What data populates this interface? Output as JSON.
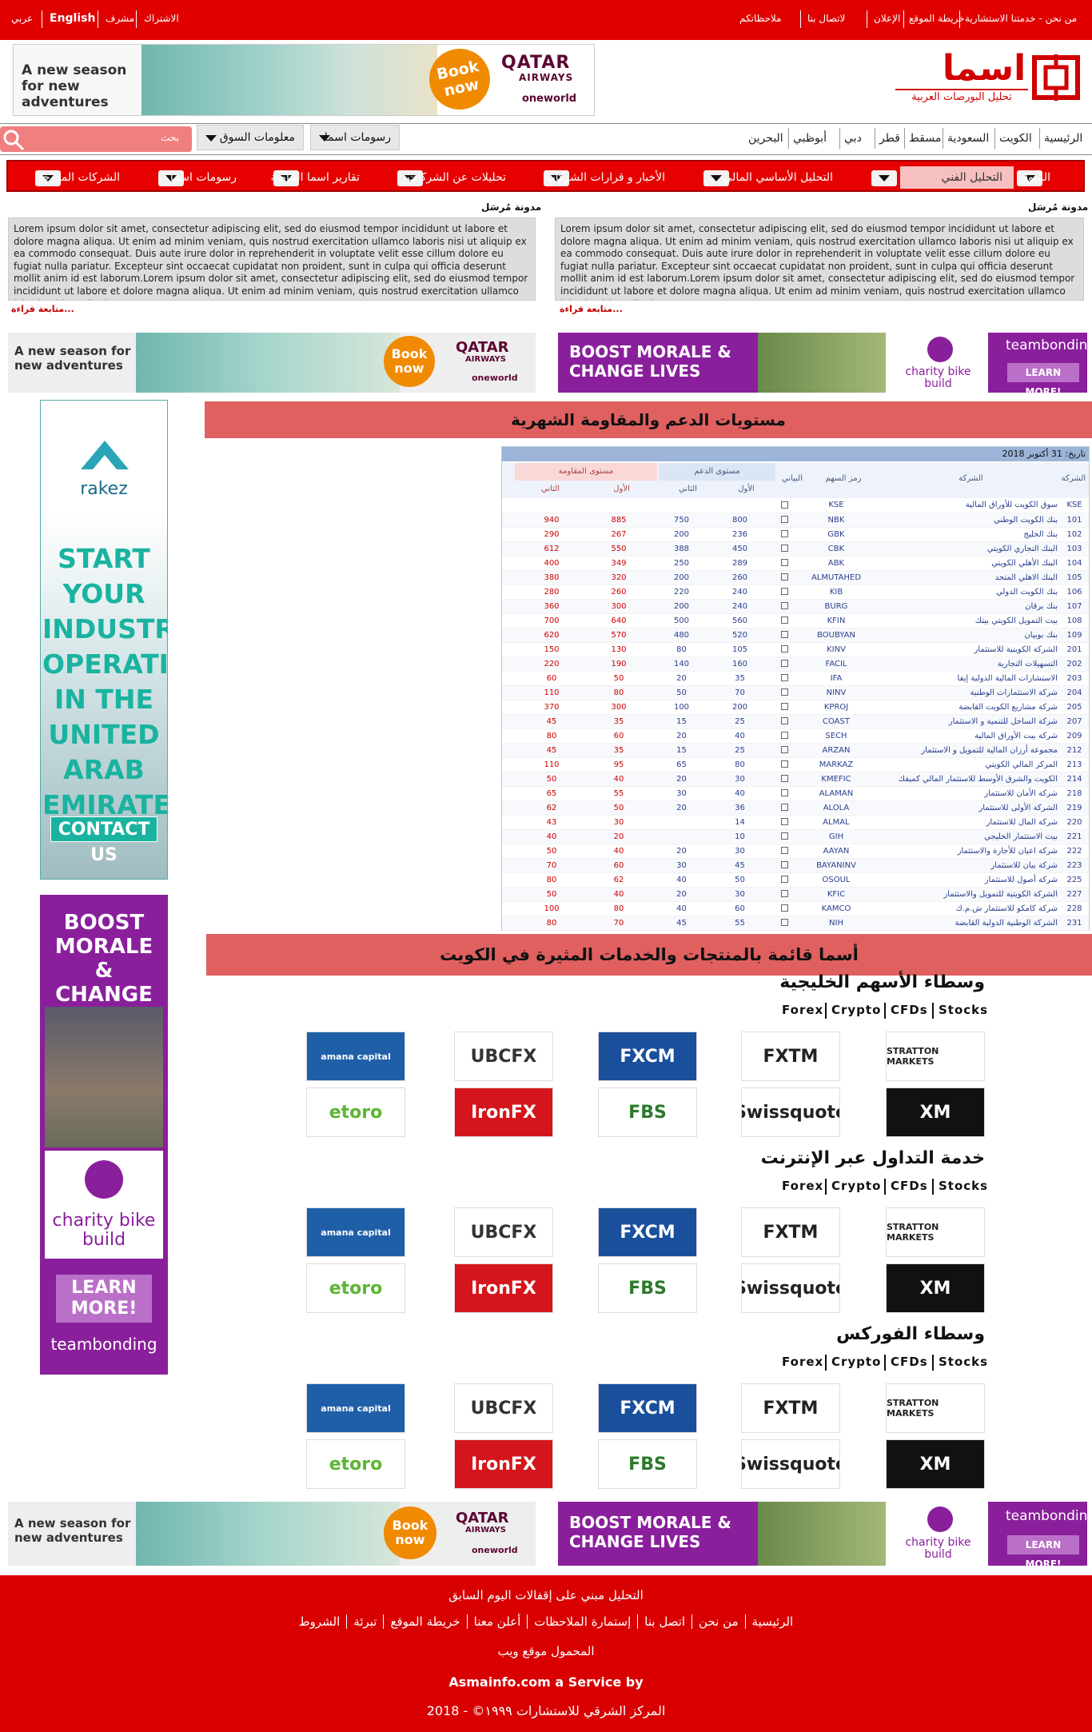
{
  "topbar": {
    "left": [
      {
        "label": "عربي"
      },
      {
        "label": "English"
      },
      {
        "label": "مشرف"
      },
      {
        "label": "الاشتراك"
      }
    ],
    "right": [
      {
        "label": "من نحن - خدمتنا الاستشارية"
      },
      {
        "label": "خريطة الموقع"
      },
      {
        "label": "الإعلان"
      },
      {
        "label": "لاتصال بنا"
      },
      {
        "label": "ملاحظاتكم"
      }
    ]
  },
  "logo": {
    "title": "اسما",
    "subtitle": "تحليل البورصات العربية"
  },
  "ads": {
    "qatar": {
      "tagline": "A new season for new adventures",
      "book": "Book now",
      "brand": "QATAR",
      "brand2": "AIRWAYS",
      "alliance": "oneworld"
    },
    "boost": {
      "headline": "BOOST MORALE & CHANGE LIVES",
      "charity": "charity bike build",
      "brand": "teambonding",
      "cta": "LEARN MORE!"
    },
    "rakez": {
      "brand": "rakez",
      "headline": "START YOUR INDUSTRIAL OPERATIONS IN THE UNITED ARAB EMIRATES",
      "cta": "CONTACT US"
    }
  },
  "nav": {
    "markets": [
      "الرئيسية",
      "الكويت",
      "السعودية",
      "مسقط",
      "قطر",
      "دبي",
      "أبوظبي",
      "البحرين"
    ],
    "dropdowns": [
      {
        "label": "رسومات اسما"
      },
      {
        "label": "معلومات السوق"
      }
    ],
    "search_placeholder": "بحث"
  },
  "menu": [
    {
      "label": "السوق"
    },
    {
      "label": "التحليل الفني"
    },
    {
      "label": "التحليل الأساسي المالي"
    },
    {
      "label": "الأخبار و قرارات الشركات"
    },
    {
      "label": "تحليلات عن الشركات"
    },
    {
      "label": "تقارير اسما الخاصة"
    },
    {
      "label": "رسومات اسما"
    },
    {
      "label": "الشركات المدرجة"
    }
  ],
  "blogs": [
    {
      "title": "مدونة مُرسَل",
      "more": "متابعة قراءة...",
      "text": "Lorem ipsum dolor sit amet, consectetur adipiscing elit, sed do eiusmod tempor incididunt ut labore et dolore magna aliqua. Ut enim ad minim veniam, quis nostrud exercitation ullamco laboris nisi ut aliquip ex ea commodo consequat. Duis aute irure dolor in reprehenderit in voluptate velit esse cillum dolore eu fugiat nulla pariatur. Excepteur sint occaecat cupidatat non proident, sunt in culpa qui officia deserunt mollit anim id est laborum.Lorem ipsum dolor sit amet, consectetur adipiscing elit, sed do eiusmod tempor incididunt ut labore et dolore magna aliqua. Ut enim ad minim veniam, quis nostrud exercitation ullamco laboris nisi ut aliquip ex ea"
    },
    {
      "title": "مدونة مُرسَل",
      "more": "متابعة قراءة...",
      "text": "Lorem ipsum dolor sit amet, consectetur adipiscing elit, sed do eiusmod tempor incididunt ut labore et dolore magna aliqua. Ut enim ad minim veniam, quis nostrud exercitation ullamco laboris nisi ut aliquip ex ea commodo consequat. Duis aute irure dolor in reprehenderit in voluptate velit esse cillum dolore eu fugiat nulla pariatur. Excepteur sint occaecat cupidatat non proident, sunt in culpa qui officia deserunt mollit anim id est laborum.Lorem ipsum dolor sit amet, consectetur adipiscing elit, sed do eiusmod tempor incididunt ut labore et dolore magna aliqua. Ut enim ad minim veniam, quis nostrud exercitation ullamco laboris nisi ut aliquip ex ea"
    }
  ],
  "levels": {
    "title": "مستويات الدعم والمقاومة الشهرية",
    "date": "تاريخ: 31 أكتوبر 2018",
    "headers": {
      "code": "الشركة",
      "company": "الشركة",
      "symbol": "رمز السهم",
      "chart": "البياني",
      "support": "مستوى الدعم",
      "resistance": "مستوى المقاومة",
      "first": "الأول",
      "second": "الثاني"
    },
    "rows": [
      {
        "n": "KSE",
        "name": "سوق الكويت للأوراق المالية",
        "sym": "KSE",
        "s1": "",
        "s2": "",
        "r1": "",
        "r2": ""
      },
      {
        "n": "101",
        "name": "بنك الكويت الوطني",
        "sym": "NBK",
        "s1": "800",
        "s2": "750",
        "r1": "885",
        "r2": "940"
      },
      {
        "n": "102",
        "name": "بنك الخليج",
        "sym": "GBK",
        "s1": "236",
        "s2": "200",
        "r1": "267",
        "r2": "290"
      },
      {
        "n": "103",
        "name": "البنك التجاري الكويتي",
        "sym": "CBK",
        "s1": "450",
        "s2": "388",
        "r1": "550",
        "r2": "612"
      },
      {
        "n": "104",
        "name": "البنك الأهلي الكويتي",
        "sym": "ABK",
        "s1": "289",
        "s2": "250",
        "r1": "349",
        "r2": "400"
      },
      {
        "n": "105",
        "name": "البنك الاهلي المتحد",
        "sym": "ALMUTAHED",
        "s1": "260",
        "s2": "200",
        "r1": "320",
        "r2": "380"
      },
      {
        "n": "106",
        "name": "بنك الكويت الدولي",
        "sym": "KIB",
        "s1": "240",
        "s2": "220",
        "r1": "260",
        "r2": "280"
      },
      {
        "n": "107",
        "name": "بنك برقان",
        "sym": "BURG",
        "s1": "240",
        "s2": "200",
        "r1": "300",
        "r2": "360"
      },
      {
        "n": "108",
        "name": "بيت التمويل الكويتي بيتك",
        "sym": "KFIN",
        "s1": "560",
        "s2": "500",
        "r1": "640",
        "r2": "700"
      },
      {
        "n": "109",
        "name": "بنك بوبيان",
        "sym": "BOUBYAN",
        "s1": "520",
        "s2": "480",
        "r1": "570",
        "r2": "620"
      },
      {
        "n": "201",
        "name": "الشركة الكويتية للاستثمار",
        "sym": "KINV",
        "s1": "105",
        "s2": "80",
        "r1": "130",
        "r2": "150"
      },
      {
        "n": "202",
        "name": "التسهيلات التجارية",
        "sym": "FACIL",
        "s1": "160",
        "s2": "140",
        "r1": "190",
        "r2": "220"
      },
      {
        "n": "203",
        "name": "الاستشارات المالية الدولية إيفا",
        "sym": "IFA",
        "s1": "35",
        "s2": "20",
        "r1": "50",
        "r2": "60"
      },
      {
        "n": "204",
        "name": "شركة الاستثمارات الوطنية",
        "sym": "NINV",
        "s1": "70",
        "s2": "50",
        "r1": "80",
        "r2": "110"
      },
      {
        "n": "205",
        "name": "شركة مشاريع الكويت القابضة",
        "sym": "KPROJ",
        "s1": "200",
        "s2": "100",
        "r1": "300",
        "r2": "370"
      },
      {
        "n": "207",
        "name": "شركة الساحل للتنمية و الاستثمار",
        "sym": "COAST",
        "s1": "25",
        "s2": "15",
        "r1": "35",
        "r2": "45"
      },
      {
        "n": "209",
        "name": "شركة بيت الأوراق المالية",
        "sym": "SECH",
        "s1": "40",
        "s2": "20",
        "r1": "60",
        "r2": "80"
      },
      {
        "n": "212",
        "name": "مجموعة أرزان المالية للتمويل و الاستثمار",
        "sym": "ARZAN",
        "s1": "25",
        "s2": "15",
        "r1": "35",
        "r2": "45"
      },
      {
        "n": "213",
        "name": "المركز المالي الكويتي",
        "sym": "MARKAZ",
        "s1": "80",
        "s2": "65",
        "r1": "95",
        "r2": "110"
      },
      {
        "n": "214",
        "name": "الكويت والشرق الأوسط للاستثمار المالي كميفك",
        "sym": "KMEFIC",
        "s1": "30",
        "s2": "20",
        "r1": "40",
        "r2": "50"
      },
      {
        "n": "218",
        "name": "شركة الأمان للاستثمار",
        "sym": "ALAMAN",
        "s1": "40",
        "s2": "30",
        "r1": "55",
        "r2": "65"
      },
      {
        "n": "219",
        "name": "الشركة الأولى للاستثمار",
        "sym": "ALOLA",
        "s1": "36",
        "s2": "20",
        "r1": "50",
        "r2": "62"
      },
      {
        "n": "220",
        "name": "شركة المال للاستثمار",
        "sym": "ALMAL",
        "s1": "14",
        "s2": "",
        "r1": "30",
        "r2": "43"
      },
      {
        "n": "221",
        "name": "بيت الاستثمار الخليجي",
        "sym": "GIH",
        "s1": "10",
        "s2": "",
        "r1": "20",
        "r2": "40"
      },
      {
        "n": "222",
        "name": "شركة اعيان للأجارة والاستثمار",
        "sym": "AAYAN",
        "s1": "30",
        "s2": "20",
        "r1": "40",
        "r2": "50"
      },
      {
        "n": "223",
        "name": "شركة بيان للاستثمار",
        "sym": "BAYANINV",
        "s1": "45",
        "s2": "30",
        "r1": "60",
        "r2": "70"
      },
      {
        "n": "225",
        "name": "شركة أصول للاستثمار",
        "sym": "OSOUL",
        "s1": "50",
        "s2": "40",
        "r1": "62",
        "r2": "80"
      },
      {
        "n": "227",
        "name": "الشركة الكويتية للتمويل والاستثمار",
        "sym": "KFIC",
        "s1": "30",
        "s2": "20",
        "r1": "40",
        "r2": "50"
      },
      {
        "n": "228",
        "name": "شركة كامكو للاستثمار ش.م.ك",
        "sym": "KAMCO",
        "s1": "60",
        "s2": "40",
        "r1": "80",
        "r2": "100"
      },
      {
        "n": "231",
        "name": "الشركة الوطنية الدولية القابضة",
        "sym": "NIH",
        "s1": "55",
        "s2": "45",
        "r1": "70",
        "r2": "80"
      }
    ]
  },
  "products": {
    "title": "أسما قائمة بالمنتجات والخدمات المثيرة في الكويت"
  },
  "broker_sections": [
    {
      "title": "وسطاء الأسهم الخليجية",
      "subs": [
        "Forex",
        "Crypto",
        "CFDs",
        "Stocks"
      ]
    },
    {
      "title": "خدمة التداول عبر الإنترنت",
      "subs": [
        "Forex",
        "Crypto",
        "CFDs",
        "Stocks"
      ]
    },
    {
      "title": "وسطاء الفوركس",
      "subs": [
        "Forex",
        "Crypto",
        "CFDs",
        "Stocks"
      ]
    }
  ],
  "brokers_row1": [
    {
      "name": "STRATTON MARKETS",
      "bg": "#ffffff",
      "fg": "#222222"
    },
    {
      "name": "FXTM",
      "bg": "#ffffff",
      "fg": "#222222"
    },
    {
      "name": "FXCM",
      "bg": "#1a4f9c",
      "fg": "#ffffff"
    },
    {
      "name": "UBCFX",
      "bg": "#ffffff",
      "fg": "#333333"
    },
    {
      "name": "amana capital",
      "bg": "#1f5fa8",
      "fg": "#ffffff"
    }
  ],
  "brokers_row2": [
    {
      "name": "XM",
      "bg": "#111111",
      "fg": "#ffffff"
    },
    {
      "name": "Swissquote",
      "bg": "#ffffff",
      "fg": "#222222"
    },
    {
      "name": "FBS",
      "bg": "#ffffff",
      "fg": "#2a7a2a"
    },
    {
      "name": "IronFX",
      "bg": "#d4161c",
      "fg": "#ffffff"
    },
    {
      "name": "etoro",
      "bg": "#ffffff",
      "fg": "#5cb531"
    }
  ],
  "footer": {
    "note": "التحليل مبني على إقفالات اليوم السابق",
    "links": [
      "الرئيسية",
      "من نحن",
      "اتصل بنا",
      "إستمارة الملاحظات",
      "أعلن معنا",
      "خريطة الموقع",
      "تبرئة",
      "الشروط"
    ],
    "mobile": "المحمول موقع ويب",
    "service": "Asmainfo.com a Service by",
    "copyright": "المركز الشرقي للاستشارات  ١٩٩٩© - 2018"
  },
  "colors": {
    "brand_red": "#e00000",
    "menu_red": "#e60000",
    "section_pink": "#e06060",
    "ad_purple": "#8a1f9c"
  }
}
